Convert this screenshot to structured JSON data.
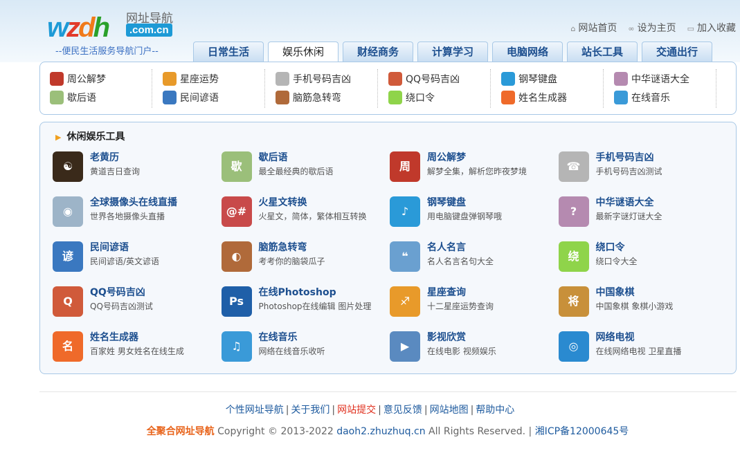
{
  "logo": {
    "text": "wzdh",
    "cn": "网址导航",
    "domain": ".com.cn",
    "slogan": "--便民生活服务导航门户--"
  },
  "toplinks": [
    {
      "icon": "home-icon",
      "label": "网站首页"
    },
    {
      "icon": "link-icon",
      "label": "设为主页"
    },
    {
      "icon": "bookmark-icon",
      "label": "加入收藏"
    }
  ],
  "tabs": [
    "日常生活",
    "娱乐休闲",
    "财经商务",
    "计算学习",
    "电脑网络",
    "站长工具",
    "交通出行"
  ],
  "active_tab": 1,
  "quick": [
    [
      "周公解梦",
      "歇后语"
    ],
    [
      "星座运势",
      "民间谚语"
    ],
    [
      "手机号码吉凶",
      "脑筋急转弯"
    ],
    [
      "QQ号码吉凶",
      "绕口令"
    ],
    [
      "钢琴键盘",
      "姓名生成器"
    ],
    [
      "中华谜语大全",
      "在线音乐"
    ]
  ],
  "section_title": "休闲娱乐工具",
  "tools": [
    {
      "name": "老黄历",
      "desc": "黄道吉日查询",
      "color": "#3a2a1a",
      "glyph": "☯"
    },
    {
      "name": "歇后语",
      "desc": "最全最经典的歇后语",
      "color": "#9bbf7a",
      "glyph": "歇"
    },
    {
      "name": "周公解梦",
      "desc": "解梦全集，解析您昨夜梦境",
      "color": "#c0392b",
      "glyph": "周"
    },
    {
      "name": "手机号码吉凶",
      "desc": "手机号码吉凶测试",
      "color": "#b5b5b5",
      "glyph": "☎"
    },
    {
      "name": "全球摄像头在线直播",
      "desc": "世界各地摄像头直播",
      "color": "#9db4c8",
      "glyph": "◉"
    },
    {
      "name": "火星文转换",
      "desc": "火星文，简体，繁体相互转换",
      "color": "#c84a4a",
      "glyph": "@#"
    },
    {
      "name": "钢琴键盘",
      "desc": "用电脑键盘弹钢琴哦",
      "color": "#2a9ad8",
      "glyph": "♪"
    },
    {
      "name": "中华谜语大全",
      "desc": "最新字谜灯谜大全",
      "color": "#b58ab0",
      "glyph": "?"
    },
    {
      "name": "民间谚语",
      "desc": "民间谚语/英文谚语",
      "color": "#3a78c0",
      "glyph": "谚"
    },
    {
      "name": "脑筋急转弯",
      "desc": "考考你的脑袋瓜子",
      "color": "#b06a3a",
      "glyph": "◐"
    },
    {
      "name": "名人名言",
      "desc": "名人名言名句大全",
      "color": "#6aa0d0",
      "glyph": "❝"
    },
    {
      "name": "绕口令",
      "desc": "绕口令大全",
      "color": "#8fd44a",
      "glyph": "绕"
    },
    {
      "name": "QQ号码吉凶",
      "desc": "QQ号码吉凶测试",
      "color": "#d05a3a",
      "glyph": "Q"
    },
    {
      "name": "在线Photoshop",
      "desc": "Photoshop在线编辑 图片处理",
      "color": "#1f5fa8",
      "glyph": "Ps"
    },
    {
      "name": "星座查询",
      "desc": "十二星座运势查询",
      "color": "#e89a2a",
      "glyph": "♐"
    },
    {
      "name": "中国象棋",
      "desc": "中国象棋 象棋小游戏",
      "color": "#c8903a",
      "glyph": "将"
    },
    {
      "name": "姓名生成器",
      "desc": "百家姓 男女姓名在线生成",
      "color": "#ef6a2a",
      "glyph": "名"
    },
    {
      "name": "在线音乐",
      "desc": "网络在线音乐收听",
      "color": "#3a9ad8",
      "glyph": "♫"
    },
    {
      "name": "影视欣赏",
      "desc": "在线电影 视频娱乐",
      "color": "#5a8ac0",
      "glyph": "▶"
    },
    {
      "name": "网络电视",
      "desc": "在线网络电视 卫星直播",
      "color": "#2a8ad0",
      "glyph": "◎"
    }
  ],
  "footer_links": [
    "个性网址导航",
    "关于我们",
    "网站提交",
    "意见反馈",
    "网站地图",
    "帮助中心"
  ],
  "copyright": {
    "brand": "全聚合网址导航",
    "text": "Copyright © 2013-2022",
    "domain": "daoh2.zhuzhuq.cn",
    "rights": "All Rights Reserved. |",
    "icp": "湘ICP备12000645号"
  }
}
